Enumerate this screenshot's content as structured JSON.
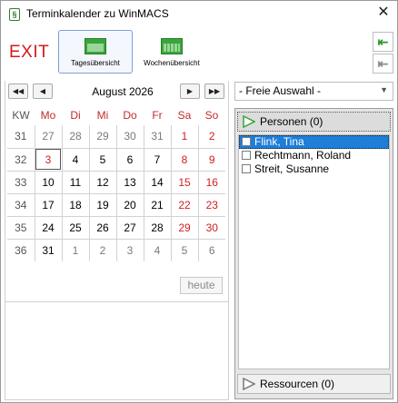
{
  "window": {
    "title": "Terminkalender zu WinMACS",
    "app_icon": "§"
  },
  "toolbar": {
    "exit_label": "EXIT",
    "day_view_label": "Tagesübersicht",
    "week_view_label": "Wochenübersicht",
    "side_buttons": [
      "green-arrow-left-icon",
      "grey-arrow-left-icon"
    ]
  },
  "calendar": {
    "month_label": "August 2026",
    "headers": [
      "KW",
      "Mo",
      "Di",
      "Mi",
      "Do",
      "Fr",
      "Sa",
      "So"
    ],
    "weeks": [
      {
        "kw": "31",
        "days": [
          "27",
          "28",
          "29",
          "30",
          "31",
          "1",
          "2"
        ]
      },
      {
        "kw": "32",
        "days": [
          "3",
          "4",
          "5",
          "6",
          "7",
          "8",
          "9"
        ]
      },
      {
        "kw": "33",
        "days": [
          "10",
          "11",
          "12",
          "13",
          "14",
          "15",
          "16"
        ]
      },
      {
        "kw": "34",
        "days": [
          "17",
          "18",
          "19",
          "20",
          "21",
          "22",
          "23"
        ]
      },
      {
        "kw": "35",
        "days": [
          "24",
          "25",
          "26",
          "27",
          "28",
          "29",
          "30"
        ]
      },
      {
        "kw": "36",
        "days": [
          "31",
          "1",
          "2",
          "3",
          "4",
          "5",
          "6"
        ]
      }
    ],
    "today_button": "heute"
  },
  "filter": {
    "selected": "- Freie Auswahl -"
  },
  "groups": {
    "persons": {
      "label": "Personen (0)",
      "items": [
        "Flink, Tina",
        "Rechtmann, Roland",
        "Streit, Susanne"
      ]
    },
    "resources": {
      "label": "Ressourcen (0)"
    }
  },
  "colors": {
    "accent_red": "#d41a1a",
    "green": "#38a63a",
    "selection": "#1e7ed8"
  }
}
